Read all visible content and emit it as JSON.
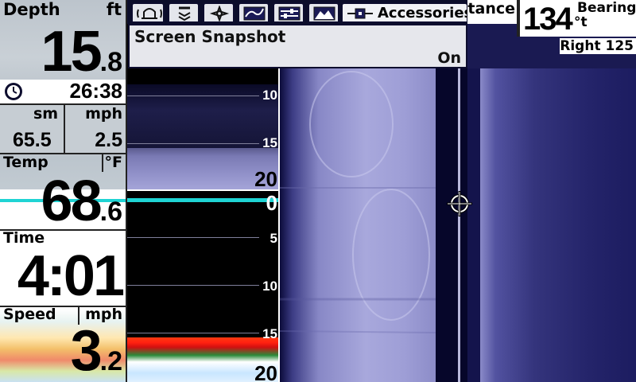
{
  "left_panel": {
    "depth": {
      "label": "Depth",
      "unit": "ft",
      "value_main": "15",
      "value_decimal": ".8"
    },
    "clock": {
      "icon": "clock-icon",
      "time": "26:38"
    },
    "distance_speed": {
      "unit_left": "sm",
      "unit_right": "mph",
      "value_left": "65.5",
      "value_right": "2.5"
    },
    "temp": {
      "label": "Temp",
      "unit": "°F",
      "value_main": "68",
      "value_decimal": ".6"
    },
    "time": {
      "label": "Time",
      "value": "4:01"
    },
    "speed": {
      "label": "Speed",
      "unit": "mph",
      "value_main": "3",
      "value_decimal": ".2"
    }
  },
  "tabs": [
    {
      "name": "alarms-tab",
      "icon": "bell-icon"
    },
    {
      "name": "sonar-tab",
      "icon": "sonar-cone-icon"
    },
    {
      "name": "navigation-tab",
      "icon": "compass-icon"
    },
    {
      "name": "chart-tab",
      "icon": "map-icon"
    },
    {
      "name": "setup-tab",
      "icon": "settings-icon"
    },
    {
      "name": "views-tab",
      "icon": "landscape-icon"
    },
    {
      "name": "accessories-tab",
      "icon": "accessories-icon",
      "label": "Accessories"
    }
  ],
  "snapshot_menu": {
    "title": "Screen Snapshot",
    "value": "On"
  },
  "readouts": {
    "distance_label": "stance",
    "bearing_value": "134",
    "bearing_label": "Bearing",
    "bearing_unit": "°t",
    "range_label": "Right 125"
  },
  "sonar_upper": {
    "depth_ticks": [
      "10",
      "15",
      "20"
    ]
  },
  "sonar_lower": {
    "depth_ticks": [
      "0",
      "5",
      "10",
      "15",
      "20"
    ]
  },
  "colors": {
    "surface_line": "#1fd4d4",
    "side_image_tint": "#9a9ad4",
    "bottom_return": "#ff2010"
  }
}
